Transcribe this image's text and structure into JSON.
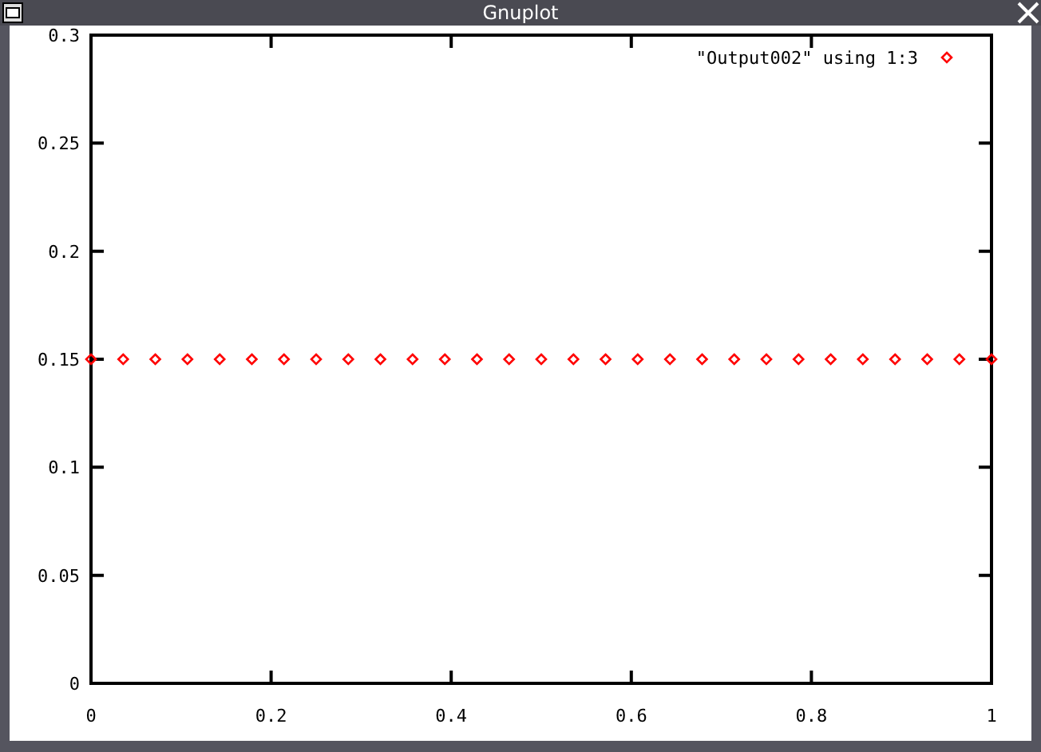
{
  "window": {
    "title": "Gnuplot"
  },
  "plot": {
    "chart_data": {
      "type": "scatter",
      "x": [
        0,
        0.0357,
        0.0714,
        0.1071,
        0.1429,
        0.1786,
        0.2143,
        0.25,
        0.2857,
        0.3214,
        0.3571,
        0.3929,
        0.4286,
        0.4643,
        0.5,
        0.5357,
        0.5714,
        0.6071,
        0.6429,
        0.6786,
        0.7143,
        0.75,
        0.7857,
        0.8214,
        0.8571,
        0.8929,
        0.9286,
        0.9643,
        1
      ],
      "series": [
        {
          "name": "\"Output002\" using 1:3",
          "color": "#ff0000",
          "values": [
            0.15,
            0.15,
            0.15,
            0.15,
            0.15,
            0.15,
            0.15,
            0.15,
            0.15,
            0.15,
            0.15,
            0.15,
            0.15,
            0.15,
            0.15,
            0.15,
            0.15,
            0.15,
            0.15,
            0.15,
            0.15,
            0.15,
            0.15,
            0.15,
            0.15,
            0.15,
            0.15,
            0.15,
            0.15
          ]
        }
      ],
      "xlim": [
        0,
        1
      ],
      "ylim": [
        0,
        0.3
      ],
      "xticks": [
        0,
        0.2,
        0.4,
        0.6,
        0.8,
        1
      ],
      "yticks": [
        0,
        0.05,
        0.1,
        0.15,
        0.2,
        0.25,
        0.3
      ]
    }
  }
}
